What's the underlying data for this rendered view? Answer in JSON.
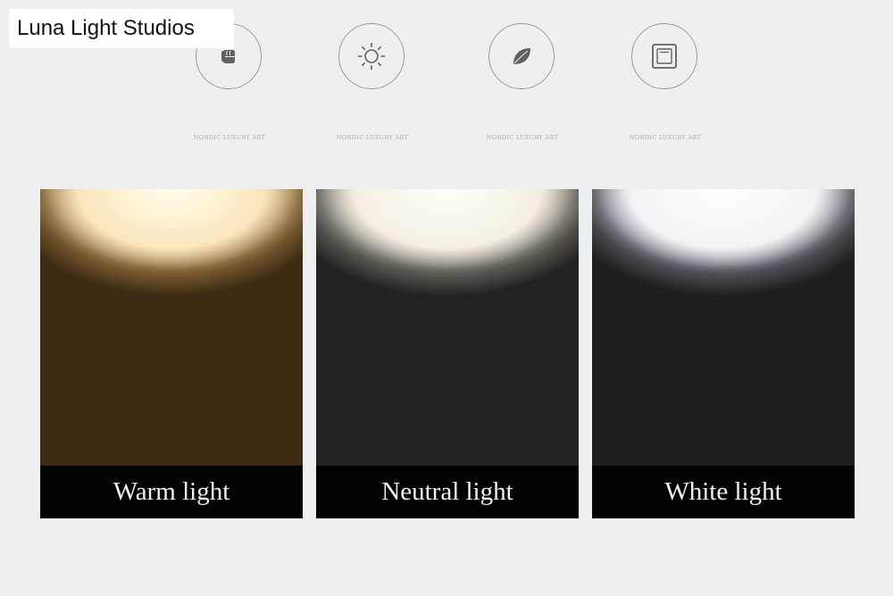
{
  "brand": {
    "name": "Luna Light Studios"
  },
  "features": [
    {
      "icon": "fist-icon",
      "caption": "NORDIC LUXURY ART"
    },
    {
      "icon": "sun-icon",
      "caption": "NORDIC LUXURY ART"
    },
    {
      "icon": "leaf-icon",
      "caption": "NORDIC LUXURY ART"
    },
    {
      "icon": "switch-icon",
      "caption": "NORDIC LUXURY ART"
    }
  ],
  "panels": [
    {
      "label": "Warm light",
      "tone": "#fbe3bc"
    },
    {
      "label": "Neutral light",
      "tone": "#f3ece1"
    },
    {
      "label": "White light",
      "tone": "#eef2f6"
    }
  ],
  "colors": {
    "background": "#eeeff1",
    "label_bar": "#030303",
    "icon_stroke": "#9a9ea3"
  }
}
